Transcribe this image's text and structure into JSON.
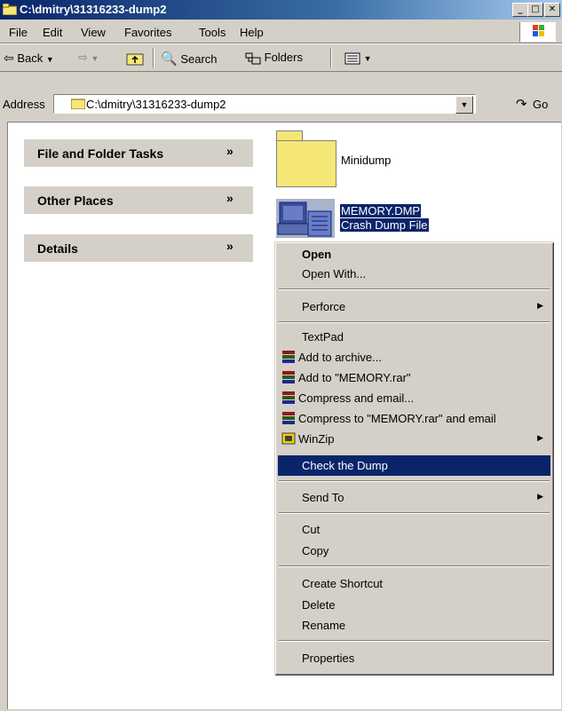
{
  "window": {
    "title": "C:\\dmitry\\31316233-dump2",
    "min_glyph": "_",
    "max_glyph": "□",
    "close_glyph": "✕"
  },
  "menubar": [
    "File",
    "Edit",
    "View",
    "Favorites",
    "Tools",
    "Help"
  ],
  "toolbar": {
    "back_label": "Back",
    "search_label": "Search",
    "folders_label": "Folders"
  },
  "address": {
    "label": "Address",
    "value": "C:\\dmitry\\31316233-dump2",
    "go_label": "Go"
  },
  "tasks": {
    "file_folder_tasks": "File and Folder Tasks",
    "other_places": "Other Places",
    "details": "Details",
    "chevron": "»"
  },
  "files": [
    {
      "name": "Minidump",
      "icon": "folder-icon"
    },
    {
      "name": "MEMORY.DMP",
      "type": "Crash Dump File",
      "icon": "dump-file-icon",
      "selected": true
    }
  ],
  "context_menu": [
    {
      "label": "Open",
      "bold": true
    },
    {
      "label": "Open With..."
    },
    {
      "separator": true
    },
    {
      "label": "Perforce",
      "submenu": true
    },
    {
      "separator": true
    },
    {
      "label": "TextPad"
    },
    {
      "label": "Add to archive...",
      "icon": "winrar-icon"
    },
    {
      "label": "Add to \"MEMORY.rar\"",
      "icon": "winrar-icon"
    },
    {
      "label": "Compress and email...",
      "icon": "winrar-icon"
    },
    {
      "label": "Compress to \"MEMORY.rar\" and email",
      "icon": "winrar-icon"
    },
    {
      "label": "WinZip",
      "icon": "winzip-icon",
      "submenu": true
    },
    {
      "label": "Check the Dump",
      "highlighted": true
    },
    {
      "separator": true
    },
    {
      "label": "Send To",
      "submenu": true
    },
    {
      "separator": true
    },
    {
      "label": "Cut"
    },
    {
      "label": "Copy"
    },
    {
      "separator": true
    },
    {
      "label": "Create Shortcut"
    },
    {
      "label": "Delete"
    },
    {
      "label": "Rename"
    },
    {
      "separator": true
    },
    {
      "label": "Properties"
    }
  ],
  "colors": {
    "title_bar": "#0a246a",
    "selection": "#0a246a",
    "window_face": "#d4d0c8",
    "folder": "#f5e776"
  }
}
